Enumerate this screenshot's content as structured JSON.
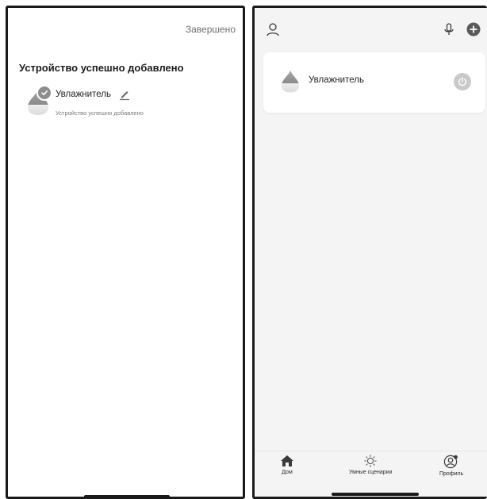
{
  "left_screen": {
    "done_label": "Завершено",
    "title": "Устройство успешно добавлено",
    "device": {
      "name": "Увлажнитель",
      "status": "Устройство успешно добавлено"
    },
    "icons": [
      "humidifier-icon",
      "check-icon",
      "pencil-icon"
    ]
  },
  "right_screen": {
    "device_card": {
      "name": "Увлажнитель"
    },
    "icons": [
      "profile-icon",
      "microphone-icon",
      "add-icon",
      "humidifier-icon",
      "power-icon"
    ],
    "tabs": [
      {
        "label": "Дом",
        "icon": "home-icon"
      },
      {
        "label": "Умные сценарии",
        "icon": "sun-icon"
      },
      {
        "label": "Профиль",
        "icon": "profile-icon"
      }
    ]
  },
  "colors": {
    "icon_gray": "#8d8d8d",
    "power_button": "#c9c9c9",
    "background_gray": "#f4f4f4"
  }
}
